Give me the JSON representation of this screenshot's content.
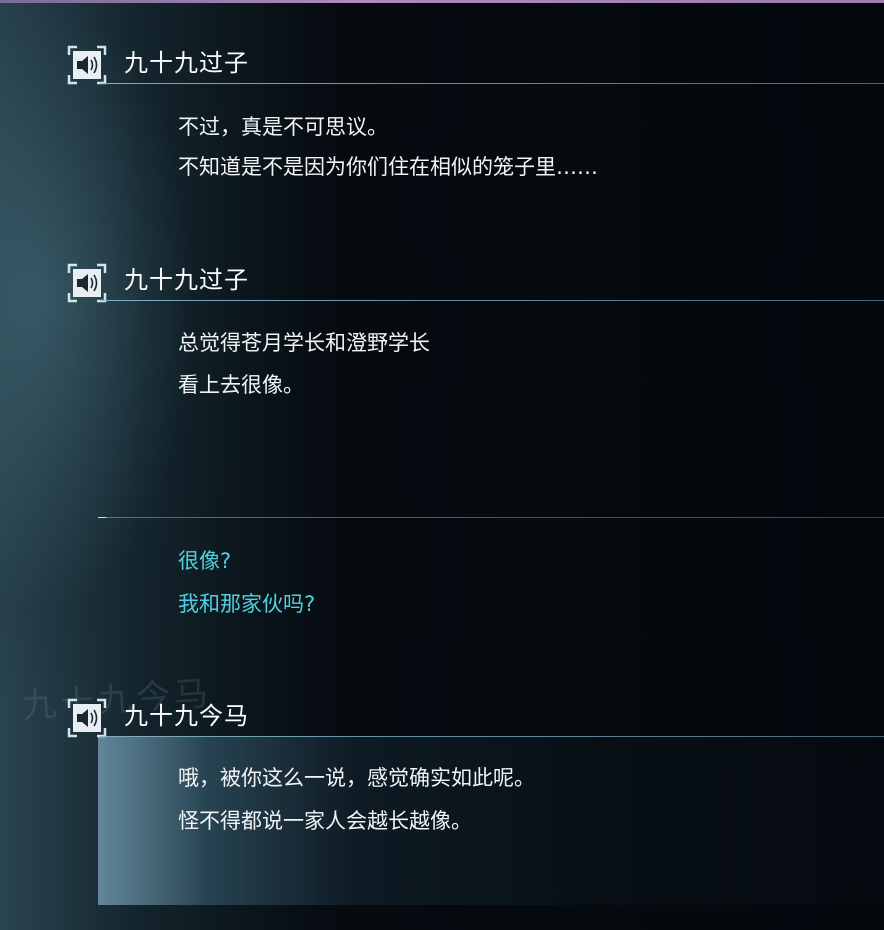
{
  "entries": [
    {
      "speaker": "九十九过子",
      "lines": [
        "不过，真是不可思议。",
        "不知道是不是因为你们住在相似的笼子里……"
      ]
    },
    {
      "speaker": "九十九过子",
      "lines": [
        "总觉得苍月学长和澄野学长",
        "看上去很像。"
      ]
    },
    {
      "speaker": "",
      "lines": [
        "很像?",
        "我和那家伙吗?"
      ]
    },
    {
      "speaker": "九十九今马",
      "lines": [
        "哦，被你这么一说，感觉确实如此呢。",
        "怪不得都说一家人会越长越像。"
      ]
    }
  ],
  "background_text": "九十九今马",
  "colors": {
    "text": "#f2f4f6",
    "player_text": "#4fd0e0",
    "rule": "#8cbed2",
    "accent": "#b08ab8"
  },
  "icons": {
    "voice_replay": "speaker-voice-icon"
  }
}
